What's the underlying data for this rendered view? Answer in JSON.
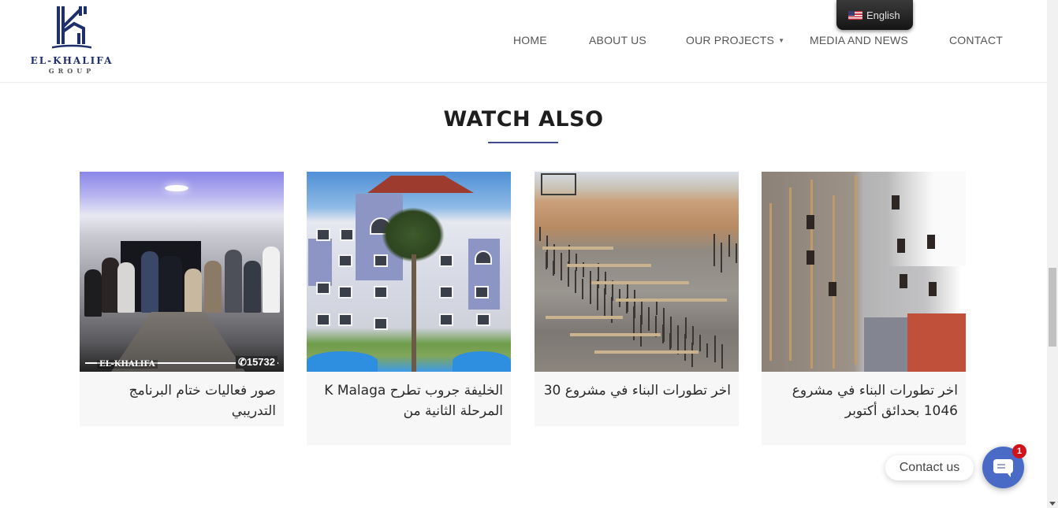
{
  "header": {
    "logo": {
      "name": "EL-KHALIFA",
      "sub": "GROUP"
    },
    "language": {
      "label": "English",
      "flag": "us-flag-icon"
    },
    "nav": [
      {
        "label": "HOME"
      },
      {
        "label": "ABOUT US"
      },
      {
        "label": "OUR PROJECTS",
        "has_dropdown": true,
        "caret": "▼"
      },
      {
        "label": "MEDIA AND NEWS"
      },
      {
        "label": "CONTACT"
      }
    ]
  },
  "section": {
    "title": "WATCH ALSO",
    "accent_color": "#3f4b8c"
  },
  "cards": [
    {
      "title": "صور فعاليات ختام البرنامج التدريبي",
      "image_alt": "office group photo",
      "watermark": {
        "brand": "EL-KHALIFA",
        "hotline": "15732"
      }
    },
    {
      "title_rtl": "الخليفة جروب تطرح ",
      "title_ltr": "K Malaga",
      "title_rest": " المرحلة الثانية من",
      "image_alt": "building render with palm tree"
    },
    {
      "title": "اخر تطورات البناء في مشروع 30",
      "image_alt": "construction site foundations"
    },
    {
      "title": "اخر تطورات البناء في مشروع 1046 بحدائق أكتوبر",
      "image_alt": "building under construction with scaffolding"
    }
  ],
  "contact_widget": {
    "label": "Contact us",
    "badge_count": "1",
    "button_color": "#4a6bc5"
  }
}
